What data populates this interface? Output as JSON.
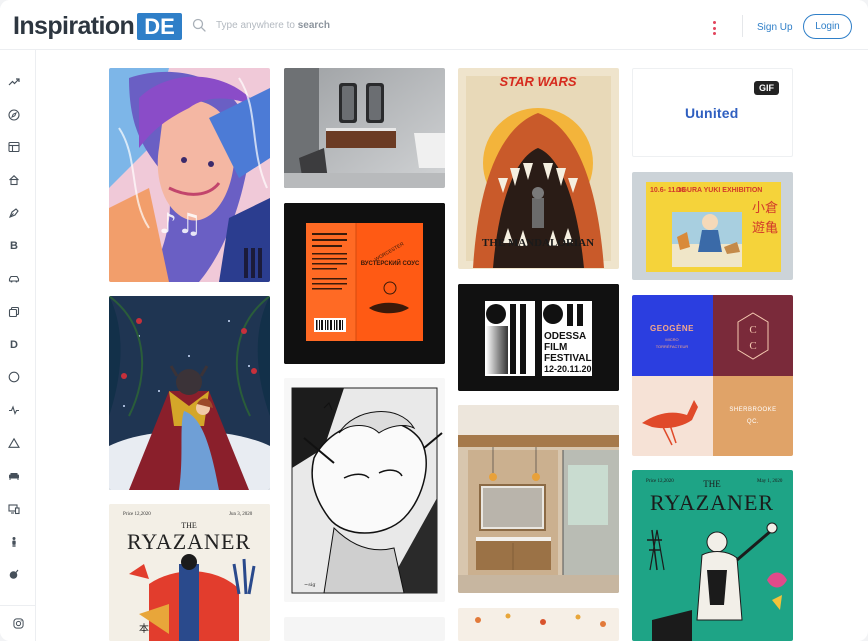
{
  "brand": {
    "name": "Inspiration",
    "badge": "DE"
  },
  "search": {
    "placeholder": "Type anywhere to search",
    "hint_prefix": "Type anywhere to ",
    "hint_bold": "search"
  },
  "header": {
    "signup_label": "Sign Up",
    "login_label": "Login"
  },
  "sidebar": {
    "items": [
      {
        "icon": "trending-icon"
      },
      {
        "icon": "compass-icon"
      },
      {
        "icon": "layout-icon"
      },
      {
        "icon": "home-icon"
      },
      {
        "icon": "pen-nib-icon"
      },
      {
        "letter": "B"
      },
      {
        "icon": "car-icon"
      },
      {
        "icon": "copy-icon"
      },
      {
        "letter": "D"
      },
      {
        "icon": "circle-icon"
      },
      {
        "icon": "activity-icon"
      },
      {
        "icon": "triangle-icon"
      },
      {
        "icon": "sofa-icon"
      },
      {
        "icon": "devices-icon"
      },
      {
        "icon": "person-icon"
      },
      {
        "icon": "bomb-icon"
      }
    ],
    "footer_icon": "instagram-icon"
  },
  "cards": {
    "gif": {
      "badge": "GIF",
      "brand_text": "Uunited"
    },
    "starwars": {
      "title": "STAR WARS",
      "subtitle": "THE MANDALORIAN"
    },
    "ogura": {
      "title": "OGURA YUKI EXHIBITION",
      "dates": "10.6- 11.18",
      "kanji": "小倉遊亀"
    },
    "sauce": {
      "text": "WORCESTERSHIRE SAUCE",
      "text_ru": "ВУСТЕРСКИЙ СОУС"
    },
    "odessa": {
      "line1": "OFF",
      "line2": "ODESSA",
      "line3": "FILM",
      "line4": "FESTIVAL",
      "line5": "12-20.11.20"
    },
    "geogene": {
      "title": "GEOGÈNE",
      "sub": "MICRO TORRÉFACTEUR",
      "mono": "C C",
      "city": "SHERBROOKE QC."
    },
    "ryazaner1": {
      "title": "RYAZANER",
      "the": "THE",
      "left_date": "Price 12,2020",
      "right_date": "Jun 3, 2020"
    },
    "ryazaner2": {
      "title": "RYAZANER",
      "the": "THE",
      "left_date": "Price 12,2020",
      "right_date": "May 1, 2020"
    }
  },
  "colors": {
    "accent": "#2f7fc8",
    "kebab": "#e2445c",
    "text": "#2d3640"
  }
}
